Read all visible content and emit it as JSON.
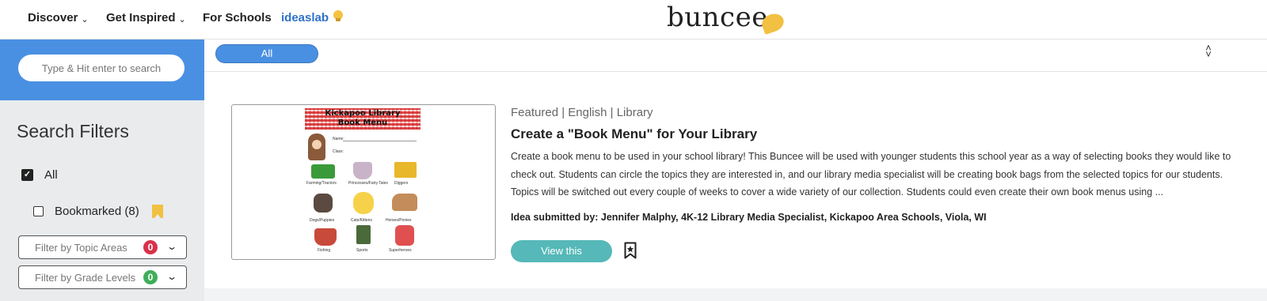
{
  "nav": {
    "items": [
      {
        "label": "Discover",
        "has_menu": true
      },
      {
        "label": "Get Inspired",
        "has_menu": true
      },
      {
        "label": "For Schools",
        "has_menu": false
      }
    ],
    "ideaslab_label": "ideaslab",
    "logo_text": "buncee",
    "chevron": "⌄"
  },
  "sidebar": {
    "search_placeholder": "Type & Hit enter to search",
    "filters_title": "Search Filters",
    "checkbox_all": {
      "label": "All",
      "checked": true
    },
    "checkbox_bookmarked": {
      "label": "Bookmarked (8)",
      "checked": false
    },
    "topic_filter": {
      "label": "Filter by Topic Areas",
      "count": "0",
      "badge_color": "#d8314b"
    },
    "grade_filter": {
      "label": "Filter by Grade Levels",
      "count": "0",
      "badge_color": "#3fae5a"
    }
  },
  "main": {
    "filter_pill": "All",
    "card": {
      "thumbnail": {
        "title_line1": "Kickapoo Library",
        "title_line2": "Book Menu",
        "name_label": "Name:",
        "class_label": "Class:",
        "topics": [
          "Farming/Tractors",
          "Princesses/Fairy Tales",
          "Diggers",
          "Dogs/Puppies",
          "Cats/Kittens",
          "Horses/Ponies",
          "Fishing",
          "Sports",
          "Superheroes"
        ]
      },
      "meta": "Featured | English | Library",
      "title": "Create a \"Book Menu\" for Your Library",
      "description": "Create a book menu to be used in your school library! This Buncee will be used with younger students this school year as a way of selecting books they would like to check out. Students can circle the topics they are interested in, and our library media specialist will be creating book bags from the selected topics for our students. Topics will be switched out every couple of weeks to cover a wide variety of our collection. Students could even create their own book menus using ...",
      "submitted_by": "Idea submitted by: Jennifer Malphy, 4K-12 Library Media Specialist, Kickapoo Area Schools, Viola, WI",
      "view_button": "View this"
    }
  },
  "colors": {
    "accent_blue": "#4a90e2",
    "button_teal": "#56b8b8",
    "logo_yellow": "#f2c042",
    "ideaslab_blue": "#2f72c9"
  },
  "icons": [
    "chevron-down-icon",
    "lightbulb-icon",
    "bookmark-icon",
    "collapse-icon",
    "check-icon"
  ]
}
